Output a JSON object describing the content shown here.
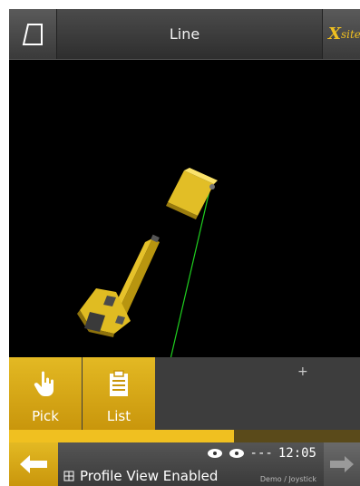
{
  "header": {
    "title": "Line",
    "logo_x": "X",
    "logo_site": "site"
  },
  "viewport": {
    "cursor_glyph": "+"
  },
  "toolbar": {
    "pick_label": "Pick",
    "list_label": "List"
  },
  "progress": {
    "value": 0.64
  },
  "status": {
    "time": "12:05",
    "link_indicator": "---",
    "message": "Profile View Enabled",
    "mode": "Demo / Joystick"
  },
  "colors": {
    "accent": "#f0c020",
    "line": "#1fd01f",
    "background": "#000000"
  }
}
